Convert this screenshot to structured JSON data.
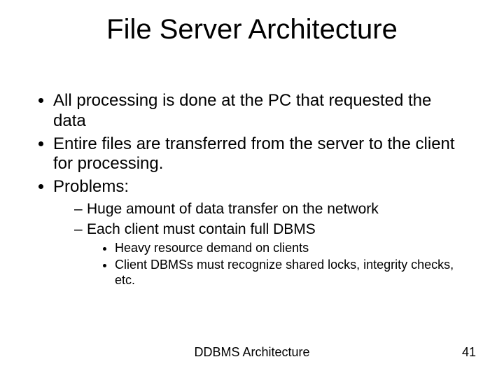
{
  "title": "File Server Architecture",
  "bullets": {
    "b1": "All processing is done at the PC that requested the data",
    "b2": "Entire files are transferred from the server to the client for processing.",
    "b3": "Problems:",
    "b3_1": "Huge amount of data transfer on the network",
    "b3_2": "Each client must contain full DBMS",
    "b3_2_1": "Heavy resource demand on clients",
    "b3_2_2": "Client DBMSs must recognize shared locks, integrity checks, etc."
  },
  "footer": {
    "center": "DDBMS Architecture",
    "page": "41"
  }
}
